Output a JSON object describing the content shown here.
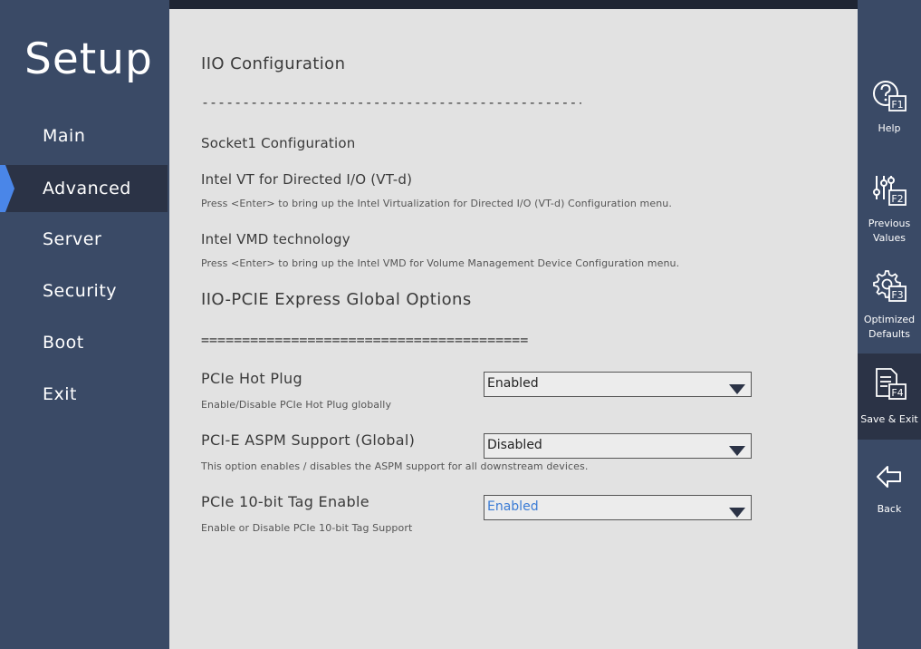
{
  "app": {
    "title": "Setup"
  },
  "nav": {
    "items": [
      {
        "label": "Main"
      },
      {
        "label": "Advanced"
      },
      {
        "label": "Server"
      },
      {
        "label": "Security"
      },
      {
        "label": "Boot"
      },
      {
        "label": "Exit"
      }
    ],
    "active_index": 1,
    "accent_color": "#4a86e8"
  },
  "main": {
    "section_title": "IIO Configuration",
    "divider_dashes": "-----------------------------------------------",
    "socket_item": "Socket1 Configuration",
    "vtd": {
      "title": "Intel VT for Directed I/O (VT-d)",
      "help": "Press <Enter> to bring up the Intel Virtualization for Directed I/O (VT-d) Configuration menu."
    },
    "vmd": {
      "title": "Intel VMD technology",
      "help": "Press <Enter> to bring up the Intel VMD for Volume Management Device Configuration menu."
    },
    "global_title": "IIO-PCIE Express Global Options",
    "divider_equals": "========================================",
    "settings": [
      {
        "label": "PCIe Hot Plug",
        "value": "Enabled",
        "help": "Enable/Disable PCIe Hot Plug globally"
      },
      {
        "label": "PCI-E ASPM Support (Global)",
        "value": "Disabled",
        "help": "This option enables / disables the ASPM support for all downstream devices."
      },
      {
        "label": "PCIe 10-bit Tag Enable",
        "value": "Enabled",
        "help": "Enable or Disable PCIe 10-bit Tag Support"
      }
    ]
  },
  "functions": [
    {
      "key": "F1",
      "label_lines": [
        "Help"
      ],
      "icon": "help-icon"
    },
    {
      "key": "F2",
      "label_lines": [
        "Previous",
        "Values"
      ],
      "icon": "sliders-icon"
    },
    {
      "key": "F3",
      "label_lines": [
        "Optimized",
        "Defaults"
      ],
      "icon": "gear-icon"
    },
    {
      "key": "F4",
      "label_lines": [
        "Save & Exit"
      ],
      "icon": "save-document-icon"
    },
    {
      "key": "",
      "label_lines": [
        "Back"
      ],
      "icon": "back-arrow-icon"
    }
  ],
  "colors": {
    "sidebar_bg": "#3a4a66",
    "active_bg": "#2b3346",
    "panel_bg": "#e2e2e2",
    "highlight_text": "#3a7bd5"
  }
}
